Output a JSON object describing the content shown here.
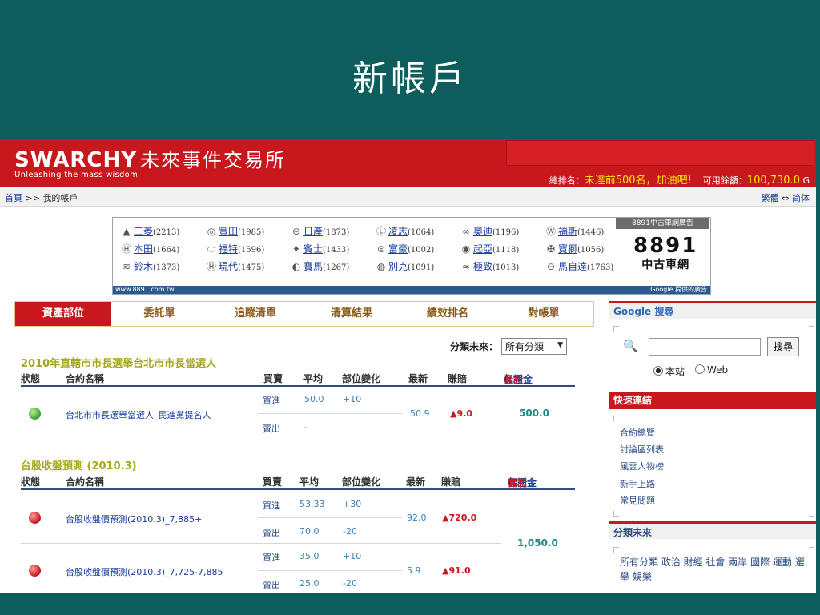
{
  "slide_title": "新帳戶",
  "header": {
    "logo": "SWARCHY",
    "logo_cn": "未來事件交易所",
    "tagline": "Unleashing the mass wisdom",
    "rank_label": "總排名：",
    "rank_value": "未達前500名，加油吧!",
    "balance_label": "可用餘額：",
    "balance_value": "100,730.0",
    "balance_unit": "G"
  },
  "breadcrumb": {
    "home": "首頁",
    "separator": ">>",
    "current": "我的帳戶",
    "lang_trad": "繁體",
    "lang_arrow": "⇔",
    "lang_simp": "简体"
  },
  "ad": {
    "brand_tag": "8891中古車網廣告",
    "logo_num": "8891",
    "logo_text": "中古車網",
    "url": "www.8891.com.tw",
    "google_note": "Google 提供的廣告",
    "rows": [
      [
        {
          "name": "三菱",
          "count": "(2213)",
          "icon": "▲"
        },
        {
          "name": "豐田",
          "count": "(1985)",
          "icon": "◎"
        },
        {
          "name": "日產",
          "count": "(1873)",
          "icon": "⊖"
        },
        {
          "name": "凌志",
          "count": "(1064)",
          "icon": "Ⓛ"
        },
        {
          "name": "奧迪",
          "count": "(1196)",
          "icon": "∞"
        },
        {
          "name": "福斯",
          "count": "(1446)",
          "icon": "Ⓦ"
        }
      ],
      [
        {
          "name": "本田",
          "count": "(1664)",
          "icon": "Ⓗ"
        },
        {
          "name": "福特",
          "count": "(1596)",
          "icon": "⬭"
        },
        {
          "name": "賓士",
          "count": "(1433)",
          "icon": "✦"
        },
        {
          "name": "富豪",
          "count": "(1002)",
          "icon": "⊜"
        },
        {
          "name": "起亞",
          "count": "(1118)",
          "icon": "◉"
        },
        {
          "name": "寶獅",
          "count": "(1056)",
          "icon": "✠"
        }
      ],
      [
        {
          "name": "鈴木",
          "count": "(1373)",
          "icon": "≋"
        },
        {
          "name": "現代",
          "count": "(1475)",
          "icon": "Ⓗ"
        },
        {
          "name": "寶馬",
          "count": "(1267)",
          "icon": "◐"
        },
        {
          "name": "別克",
          "count": "(1091)",
          "icon": "◍"
        },
        {
          "name": "極致",
          "count": "(1013)",
          "icon": "≈"
        },
        {
          "name": "馬自達",
          "count": "(1763)",
          "icon": "⊝"
        }
      ]
    ]
  },
  "tabs": [
    "資產部位",
    "委託單",
    "追蹤清單",
    "清算結果",
    "績效排名",
    "對帳單"
  ],
  "filter": {
    "label": "分類未來：",
    "value": "所有分類"
  },
  "columns": {
    "status": "狀態",
    "contract": "合約名稱",
    "side": "買賣",
    "avg": "平均",
    "change": "部位變化",
    "latest": "最新",
    "pnl": "賺賠",
    "margin": "保證金",
    "slash": "/",
    "arb": "套利"
  },
  "sections": [
    {
      "title": "2010年直轄市市長選舉台北市市長當選人",
      "rows": [
        {
          "status": "green",
          "contract": "台北市市長選舉當選人_民進黨提名人",
          "buy_label": "買進",
          "buy_avg": "50.0",
          "buy_change": "+10",
          "sell_label": "賣出",
          "sell_avg": "-",
          "sell_change": "",
          "latest": "50.9",
          "pnl": "▲9.0",
          "margin": "500.0"
        }
      ]
    },
    {
      "title": "台股收盤預測 (2010.3)",
      "margin_total": "1,050.0",
      "rows": [
        {
          "status": "red",
          "contract": "台股收盤價預測(2010.3)_7,885+",
          "buy_label": "買進",
          "buy_avg": "53.33",
          "buy_change": "+30",
          "sell_label": "賣出",
          "sell_avg": "70.0",
          "sell_change": "-20",
          "latest": "92.0",
          "pnl": "▲720.0"
        },
        {
          "status": "red",
          "contract": "台股收盤價預測(2010.3)_7,725-7,885",
          "buy_label": "買進",
          "buy_avg": "35.0",
          "buy_change": "+10",
          "sell_label": "賣出",
          "sell_avg": "25.0",
          "sell_change": "-20",
          "latest": "5.9",
          "pnl": "▲91.0"
        }
      ]
    }
  ],
  "sidebar": {
    "google_title": "Google 搜尋",
    "search_button": "搜尋",
    "radio_site": "本站",
    "radio_web": "Web",
    "quick_title": "快速連結",
    "quick_links": [
      "合約總覽",
      "討論區列表",
      "風雲人物榜",
      "新手上路",
      "常見問題"
    ],
    "cat_title": "分類未來",
    "categories": "所有分類 政治 財經 社會 兩岸 國際 運動 選舉 娛樂"
  },
  "colors": {
    "background": "#0c5d5c",
    "brand_red": "#c9171e",
    "link_blue": "#1a3d9e",
    "highlight_yellow": "#ffea00"
  }
}
